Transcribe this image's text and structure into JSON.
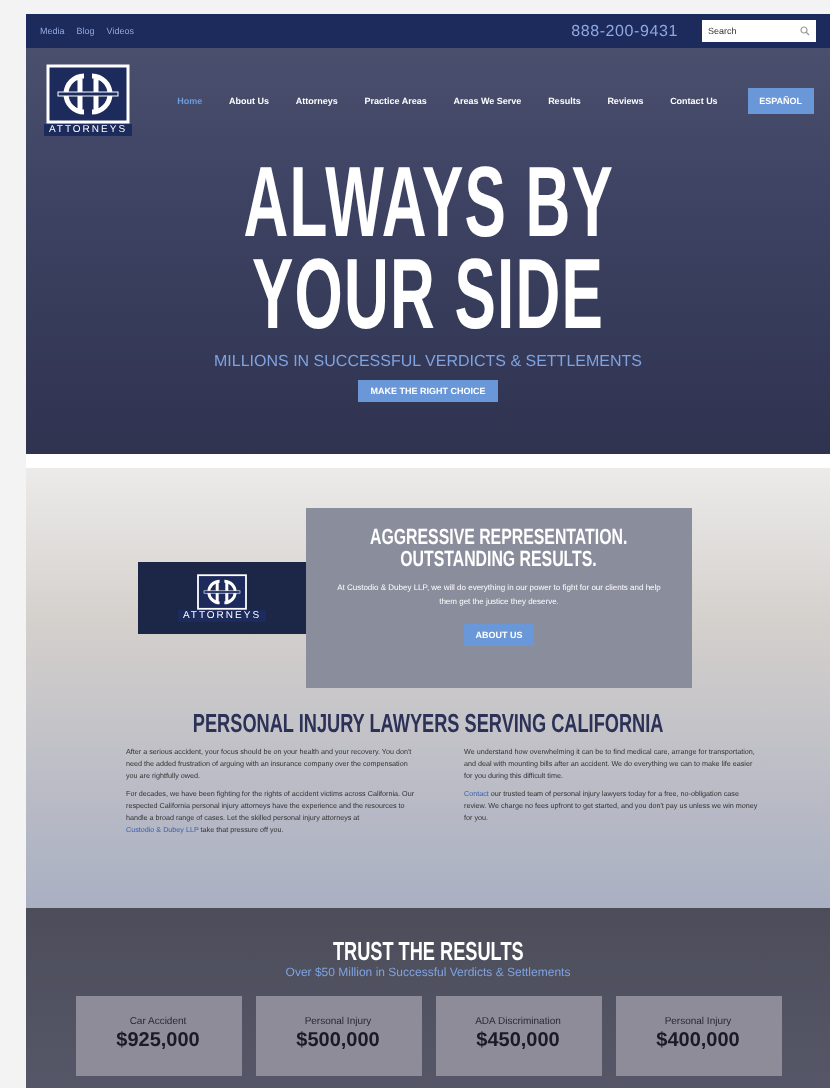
{
  "top_bar": {
    "links": [
      "Media",
      "Blog",
      "Videos"
    ],
    "phone": "888-200-9431",
    "search": {
      "placeholder": "Search"
    }
  },
  "header": {
    "logo_caption": "ATTORNEYS",
    "nav": [
      {
        "label": "Home",
        "selected": true
      },
      {
        "label": "About Us",
        "selected": false
      },
      {
        "label": "Attorneys",
        "selected": false
      },
      {
        "label": "Practice Areas",
        "selected": false
      },
      {
        "label": "Areas We Serve",
        "selected": false
      },
      {
        "label": "Results",
        "selected": false
      },
      {
        "label": "Reviews",
        "selected": false
      },
      {
        "label": "Contact Us",
        "selected": false
      }
    ],
    "language_button": "ESPAÑOL"
  },
  "hero": {
    "title_lines": [
      "ALWAYS BY",
      "YOUR SIDE"
    ],
    "subtitle": "MILLIONS IN SUCCESSFUL VERDICTS & SETTLEMENTS",
    "button": "MAKE THE RIGHT CHOICE"
  },
  "intro": {
    "video_caption": "ATTORNEYS",
    "title_lines": [
      "AGGRESSIVE REPRESENTATION.",
      "OUTSTANDING RESULTS."
    ],
    "text": "At Custodio & Dubey LLP, we will do everything in our power to fight for our clients and help them get the justice they deserve.",
    "button": "ABOUT US"
  },
  "about": {
    "title": "PERSONAL INJURY LAWYERS SERVING CALIFORNIA",
    "columns": [
      [
        {
          "before": "After a serious accident, your focus should be on your health and your recovery. You don't need the added frustration of arguing with an insurance company over the compensation you are rightfully owed."
        },
        {
          "before": "For decades, we have been fighting for the rights of accident victims across California. Our respected California personal injury attorneys have the experience and the resources to handle a broad range of cases. Let the skilled personal injury attorneys at ",
          "link": "Custodio & Dubey LLP",
          "after": " take that pressure off you."
        }
      ],
      [
        {
          "before": "We understand how overwhelming it can be to find medical care, arrange for transportation, and deal with mounting bills after an accident. We do everything we can to make life easier for you during this difficult time."
        },
        {
          "link": "Contact",
          "after": " our trusted team of personal injury lawyers today for a free, no-obligation case review. We charge no fees upfront to get started, and you don't pay us unless we win money for you."
        }
      ]
    ]
  },
  "results": {
    "title": "TRUST THE RESULTS",
    "subtitle": "Over $50 Million in Successful Verdicts & Settlements",
    "cards": [
      {
        "label": "Car Accident",
        "amount": "$925,000"
      },
      {
        "label": "Personal Injury",
        "amount": "$500,000"
      },
      {
        "label": "ADA Discrimination",
        "amount": "$450,000"
      },
      {
        "label": "Personal Injury",
        "amount": "$400,000"
      }
    ]
  }
}
